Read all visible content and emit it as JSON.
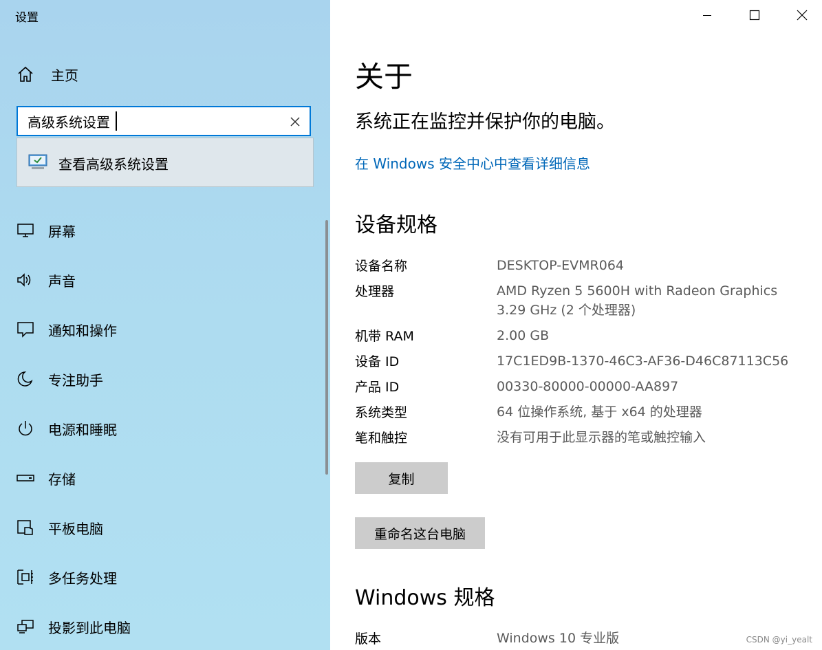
{
  "window": {
    "title": "设置",
    "minimize_icon": "minimize-icon",
    "maximize_icon": "maximize-icon",
    "close_icon": "close-icon"
  },
  "sidebar": {
    "home": {
      "label": "主页",
      "icon": "home-icon"
    },
    "search": {
      "value": "高级系统设置",
      "clear_icon": "clear-icon"
    },
    "suggestion": {
      "label": "查看高级系统设置",
      "icon": "monitor-settings-icon"
    },
    "items": [
      {
        "label": "屏幕",
        "icon": "display-icon"
      },
      {
        "label": "声音",
        "icon": "speaker-icon"
      },
      {
        "label": "通知和操作",
        "icon": "notification-icon"
      },
      {
        "label": "专注助手",
        "icon": "moon-icon"
      },
      {
        "label": "电源和睡眠",
        "icon": "power-icon"
      },
      {
        "label": "存储",
        "icon": "storage-icon"
      },
      {
        "label": "平板电脑",
        "icon": "tablet-icon"
      },
      {
        "label": "多任务处理",
        "icon": "multitask-icon"
      },
      {
        "label": "投影到此电脑",
        "icon": "project-icon"
      }
    ],
    "accent_color": "#0078d7"
  },
  "main": {
    "title": "关于",
    "status": "系统正在监控并保护你的电脑。",
    "security_link": "在 Windows 安全中心中查看详细信息",
    "device_specs": {
      "heading": "设备规格",
      "rows": [
        {
          "label": "设备名称",
          "value": "DESKTOP-EVMR064"
        },
        {
          "label": "处理器",
          "value": "AMD Ryzen 5 5600H with Radeon Graphics",
          "value2": "3.29 GHz  (2 个处理器)"
        },
        {
          "label": "机带 RAM",
          "value": "2.00 GB"
        },
        {
          "label": "设备 ID",
          "value": "17C1ED9B-1370-46C3-AF36-D46C87113C56"
        },
        {
          "label": "产品 ID",
          "value": "00330-80000-00000-AA897"
        },
        {
          "label": "系统类型",
          "value": "64 位操作系统, 基于 x64 的处理器"
        },
        {
          "label": "笔和触控",
          "value": "没有可用于此显示器的笔或触控输入"
        }
      ],
      "copy_button": "复制",
      "rename_button": "重命名这台电脑"
    },
    "windows_specs": {
      "heading": "Windows 规格",
      "rows": [
        {
          "label": "版本",
          "value": "Windows 10 专业版"
        }
      ]
    },
    "link_color": "#0067b8"
  },
  "watermark": "CSDN @yi_yealt"
}
